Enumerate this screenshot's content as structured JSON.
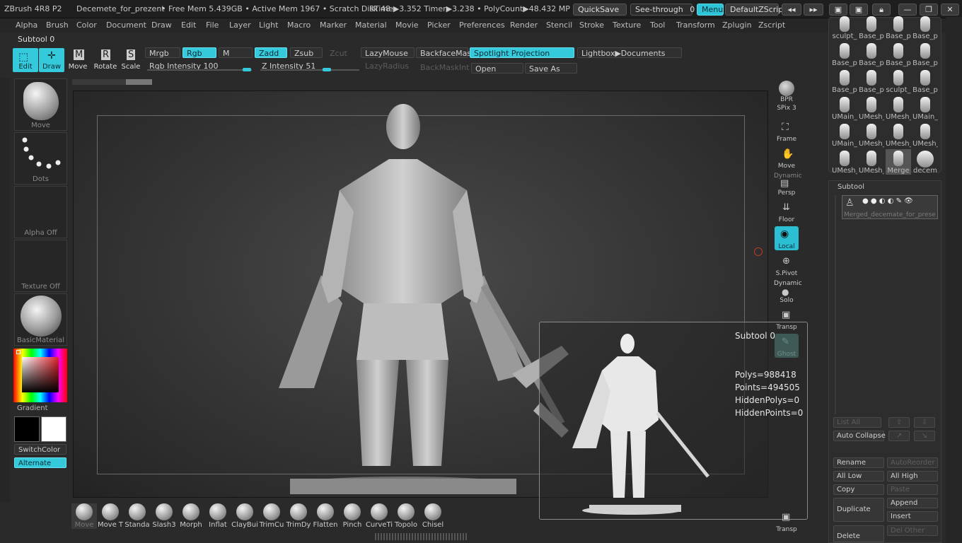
{
  "titlebar": {
    "app": "ZBrush 4R8 P2",
    "document": "Decemete_for_prezent",
    "stats": "• Free Mem 5.439GB • Active Mem 1967 • Scratch Disk 48 •",
    "rtime": "RTime▶3.352 Timer▶3.238 • PolyCount▶48.432 MP • Me",
    "quicksave": "QuickSave",
    "see_through_label": "See-through",
    "see_through_value": "0",
    "menus": "Menus",
    "default_zscript": "DefaultZScript"
  },
  "menu": [
    "Alpha",
    "Brush",
    "Color",
    "Document",
    "Draw",
    "Edit",
    "File",
    "Layer",
    "Light",
    "Macro",
    "Marker",
    "Material",
    "Movie",
    "Picker",
    "Preferences",
    "Render",
    "Stencil",
    "Stroke",
    "Texture",
    "Tool",
    "Transform",
    "Zplugin",
    "Zscript"
  ],
  "subtool_label": "Subtool 0",
  "shelf": {
    "tools": [
      {
        "label": "Edit",
        "on": true
      },
      {
        "label": "Draw",
        "on": true
      },
      {
        "label": "Move",
        "key": "M",
        "on": false
      },
      {
        "label": "Rotate",
        "key": "R",
        "on": false
      },
      {
        "label": "Scale",
        "key": "S",
        "on": false
      }
    ],
    "mrgb": "Mrgb",
    "rgb": "Rgb",
    "m": "M",
    "rgb_intensity": "Rgb Intensity 100",
    "zadd": "Zadd",
    "zsub": "Zsub",
    "zcut": "Zcut",
    "z_intensity": "Z Intensity 51",
    "lazymouse": "LazyMouse",
    "lazyradius": "LazyRadius",
    "backfacemask": "BackfaceMask",
    "backmaskint": "BackMaskInt",
    "spotlight": "Spotlight Projection",
    "open": "Open",
    "lightbox": "Lightbox▶Documents",
    "save_as": "Save As"
  },
  "left": {
    "brush": "Move",
    "stroke": "Dots",
    "alpha": "Alpha Off",
    "texture": "Texture Off",
    "material": "BasicMaterial",
    "gradient": "Gradient",
    "switchcolor": "SwitchColor",
    "alternate": "Alternate"
  },
  "right_tools": [
    "BPR",
    "SPix 3",
    "Frame",
    "Move",
    "Persp",
    "Floor",
    "Local",
    "S.Pivot",
    "Solo",
    "Transp",
    "Ghost",
    "Transp"
  ],
  "right_tools_extra": {
    "dynamic1": "Dynamic",
    "dynamic2": "Dynamic"
  },
  "brushes": [
    "Move",
    "Move T",
    "Standa",
    "Slash3",
    "Morph",
    "Inflat",
    "ClayBui",
    "TrimCu",
    "TrimDy",
    "Flatten",
    "Pinch",
    "CurveTi",
    "Topolo",
    "Chisel"
  ],
  "tool_thumbs": [
    "sculpt_",
    "Base_p",
    "Base_p",
    "Base_p",
    "Base_p",
    "Base_p",
    "Base_p",
    "Base_p",
    "Base_p",
    "Base_p",
    "sculpt_",
    "Base_p",
    "UMain_",
    "UMesh_",
    "UMesh_",
    "UMain_",
    "UMain_",
    "UMesh_",
    "UMesh_",
    "UMesh_",
    "UMesh_",
    "UMesh_",
    "Merge",
    "decem"
  ],
  "subtool_panel": {
    "title": "Subtool",
    "item_name": "Merged_decemate_for_prese",
    "list_all": "List All",
    "auto_collapse": "Auto Collapse",
    "rename": "Rename",
    "autoreorder": "AutoReorder",
    "all_low": "All Low",
    "all_high": "All High",
    "copy": "Copy",
    "paste": "Paste",
    "duplicate": "Duplicate",
    "append": "Append",
    "insert": "Insert",
    "delete": "Delete",
    "del_other": "Del Other"
  },
  "popup": {
    "title": "Subtool 0",
    "polys": "Polys=988418",
    "points": "Points=494505",
    "hidden_polys": "HiddenPolys=0",
    "hidden_points": "HiddenPoints=0"
  },
  "colors": {
    "accent": "#35c9dc",
    "main_color": "#000000",
    "secondary_color": "#ffffff"
  }
}
